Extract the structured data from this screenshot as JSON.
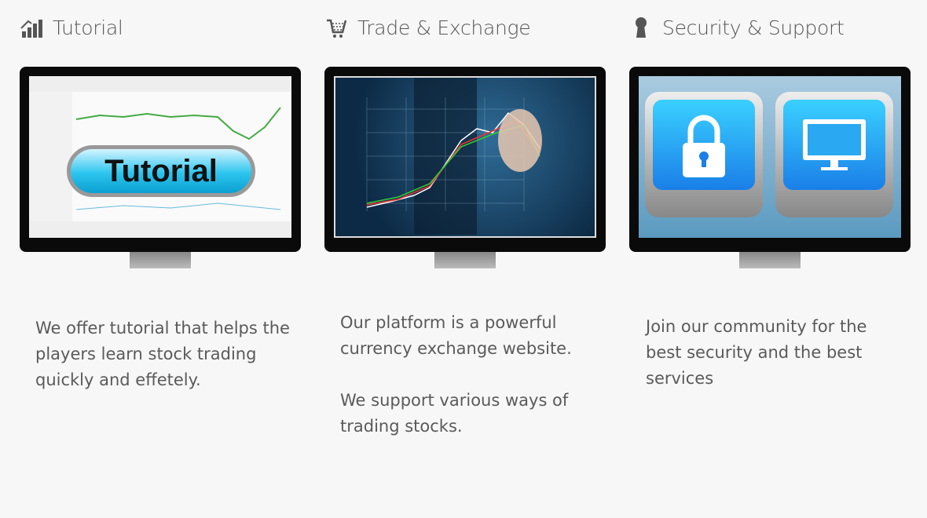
{
  "columns": [
    {
      "title": "Tutorial",
      "icon": "bar-chart-icon",
      "screen_label": "Tutorial",
      "paragraphs": [
        "We offer tutorial that helps the players learn stock trading quickly and effetely."
      ]
    },
    {
      "title": "Trade & Exchange",
      "icon": "shopping-cart-icon",
      "paragraphs": [
        "Our platform is a powerful currency exchange website.",
        "We support various ways of trading stocks."
      ]
    },
    {
      "title": "Security & Support",
      "icon": "keyhole-icon",
      "paragraphs": [
        "Join our community for the best security and the best services"
      ]
    }
  ],
  "colors": {
    "background": "#f7f7f7",
    "text": "#555555",
    "accent": "#1aa3e8"
  }
}
